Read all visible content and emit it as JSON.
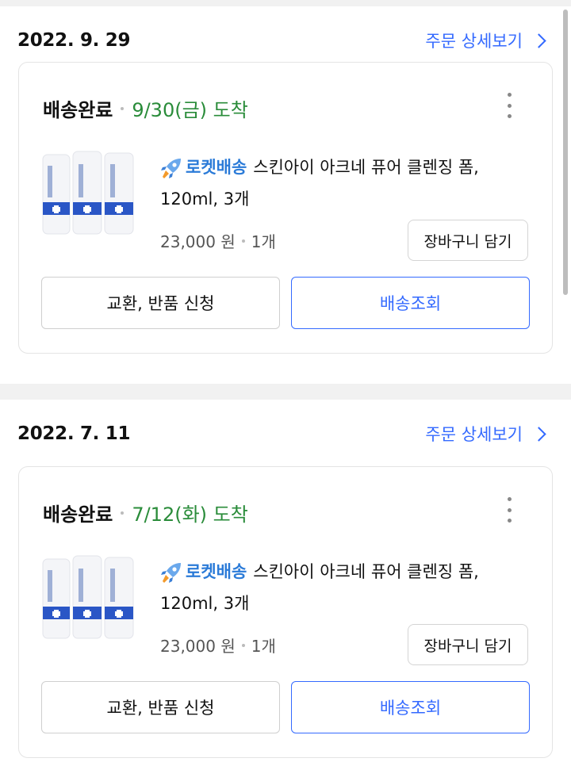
{
  "orders": [
    {
      "date": "2022. 9. 29",
      "detail_label": "주문 상세보기",
      "status": "배송완료",
      "arrival": "9/30(금) 도착",
      "rocket_label": "로켓배송",
      "product_name": "스킨아이 아크네 퓨어 클렌징 폼, 120ml, 3개",
      "price": "23,000 원",
      "quantity": "1개",
      "cart_button": "장바구니 담기",
      "return_button": "교환, 반품 신청",
      "tracking_button": "배송조회"
    },
    {
      "date": "2022. 7. 11",
      "detail_label": "주문 상세보기",
      "status": "배송완료",
      "arrival": "7/12(화) 도착",
      "rocket_label": "로켓배송",
      "product_name": "스킨아이 아크네 퓨어 클렌징 폼, 120ml, 3개",
      "price": "23,000 원",
      "quantity": "1개",
      "cart_button": "장바구니 담기",
      "return_button": "교환, 반품 신청",
      "tracking_button": "배송조회"
    }
  ],
  "colors": {
    "accent_blue": "#346aff",
    "arrival_green": "#2a8c3a",
    "rocket_blue": "#2b7bd8"
  },
  "icons": {
    "more": "more-vertical-icon",
    "chevron": "chevron-right-icon",
    "rocket": "rocket-icon"
  }
}
